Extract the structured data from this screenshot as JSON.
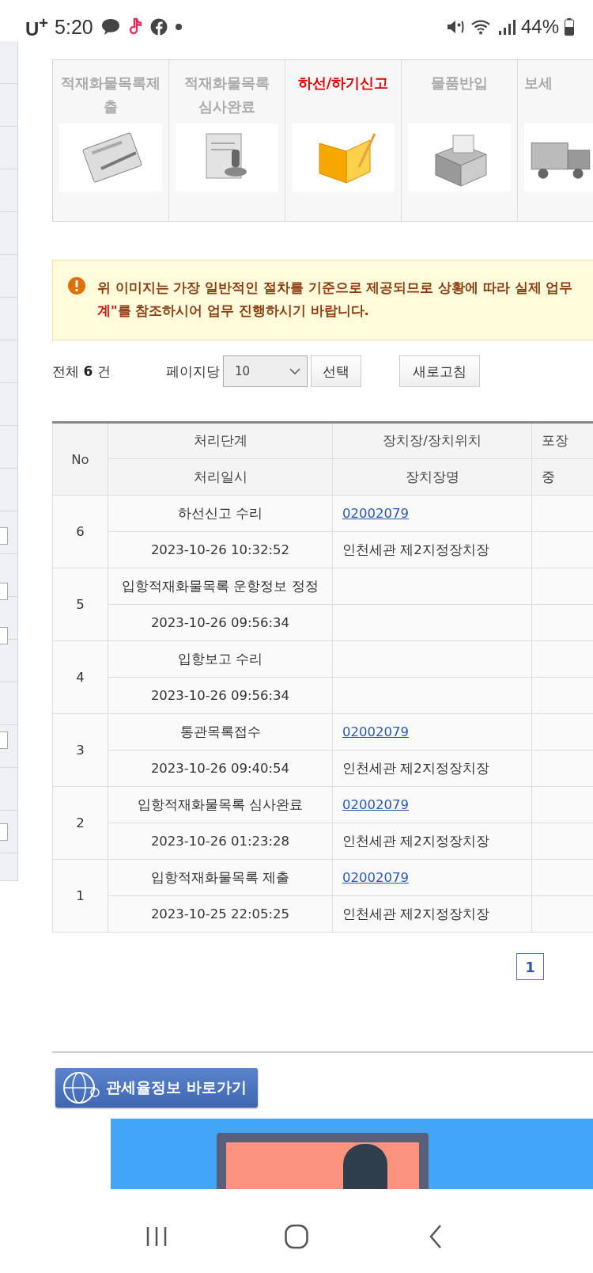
{
  "status_bar": {
    "carrier": "U$^{+}$",
    "time": "5:20",
    "battery": "44%"
  },
  "steps": [
    {
      "label": "적재화물목록제출",
      "kind": "clipboard",
      "selected": false
    },
    {
      "label": "적재화물목록 심사완료",
      "kind": "stamp",
      "selected": false
    },
    {
      "label": "하선/하기신고",
      "kind": "folder",
      "selected": true
    },
    {
      "label": "물품반입",
      "kind": "box",
      "selected": false
    },
    {
      "label": "보세",
      "kind": "truck",
      "selected": false
    }
  ],
  "notice": {
    "line_1": "위 이미지는 가장 일반적인 절차를 기준으로 제공되므로 상황에 따라 실제 업무",
    "highlight": "계\"",
    "line_2": "를 참조하시어 업무 진행하시기 바랍니다."
  },
  "list_controls": {
    "total_label": "전체",
    "total_count": "6",
    "total_unit": "건",
    "page_size_label": "페이지당",
    "page_size": "10",
    "select_button": "선택",
    "refresh_button": "새로고침"
  },
  "table": {
    "columns": [
      {
        "top": "No"
      },
      {
        "top": "처리단계",
        "bottom": "처리일시"
      },
      {
        "top": "장치장/장치위치",
        "bottom": "장치장명"
      },
      {
        "top": "포장",
        "bottom": "중"
      }
    ],
    "rows": [
      {
        "no": "6",
        "stage": "하선신고 수리",
        "datetime": "2023-10-26 10:32:52",
        "location_code": "02002079",
        "location_name": "인천세관 제2지정장치장"
      },
      {
        "no": "5",
        "stage": "입항적재화물목록 운항정보 정정",
        "datetime": "2023-10-26 09:56:34"
      },
      {
        "no": "4",
        "stage": "입항보고 수리",
        "datetime": "2023-10-26 09:56:34"
      },
      {
        "no": "3",
        "stage": "통관목록접수",
        "datetime": "2023-10-26 09:40:54",
        "location_code": "02002079",
        "location_name": "인천세관 제2지정장치장"
      },
      {
        "no": "2",
        "stage": "입항적재화물목록 심사완료",
        "datetime": "2023-10-26 01:23:28",
        "location_code": "02002079",
        "location_name": "인천세관 제2지정장치장"
      },
      {
        "no": "1",
        "stage": "입항적재화물목록 제출",
        "datetime": "2023-10-25 22:05:25",
        "location_code": "02002079",
        "location_name": "인천세관 제2지정장치장"
      }
    ]
  },
  "pagination": [
    {
      "label": "1",
      "selected": true
    }
  ],
  "tariff_link": "관세율정보 바로가기"
}
